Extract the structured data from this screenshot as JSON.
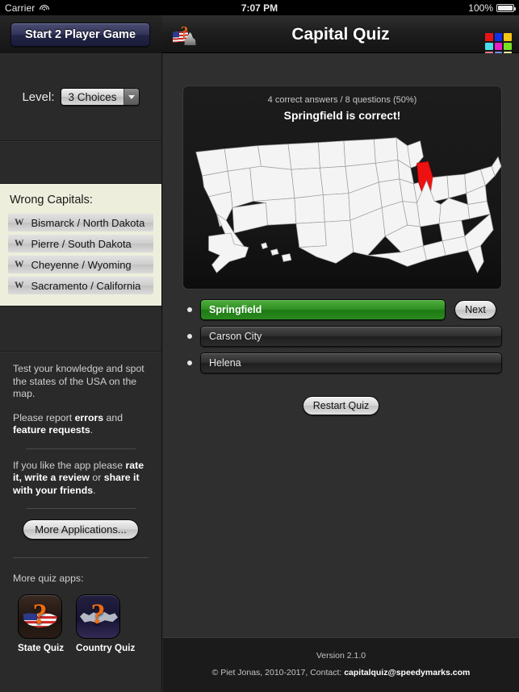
{
  "statusbar": {
    "carrier": "Carrier",
    "wifi_icon": "wifi-icon",
    "time": "7:07 PM",
    "battery_percent": "100%",
    "battery_icon": "battery-full-icon"
  },
  "navbar": {
    "two_player_button": "Start 2 Player Game",
    "app_icon": "capital-quiz-app-icon",
    "title": "Capital Quiz",
    "grid_icon": "color-grid-icon",
    "grid_colors": [
      "#e81414",
      "#1430e8",
      "#f5c518",
      "#46e0e8",
      "#e81ec8",
      "#7ae024",
      "#f07a8c",
      "#7a8cf0",
      "#f2ee9a"
    ]
  },
  "sidebar": {
    "level": {
      "label": "Level:",
      "selected": "3 Choices",
      "dropdown_icon": "chevron-down-icon"
    },
    "wrong_capitals": {
      "title": "Wrong Capitals:",
      "badge": "W",
      "items": [
        "Bismarck / North Dakota",
        "Pierre / South Dakota",
        "Cheyenne / Wyoming",
        "Sacramento / California"
      ]
    },
    "info": {
      "paragraph1_plain": "Test your knowledge and spot the states of the USA on the map.",
      "p2_a": "Please report ",
      "p2_b": "errors",
      "p2_c": " and ",
      "p2_d": "feature requests",
      "p2_e": ".",
      "p3_a": "If you like the app please ",
      "p3_b": "rate it, write a review",
      "p3_c": " or ",
      "p3_d": "share it with your friends",
      "p3_e": "."
    },
    "more_applications_button": "More Applications...",
    "more_quiz_apps_label": "More quiz apps:",
    "quiz_apps": [
      {
        "name": "State Quiz",
        "icon": "state-quiz-icon"
      },
      {
        "name": "Country Quiz",
        "icon": "country-quiz-icon"
      }
    ]
  },
  "quiz": {
    "score_line": "4 correct answers / 8 questions (50%)",
    "result_line": "Springfield is correct!",
    "map": {
      "icon": "usa-map",
      "highlighted_state": "Illinois",
      "highlight_color": "#ee1111",
      "state_fill": "#f4f4f4",
      "background": "#141414"
    },
    "answers": [
      {
        "label": "Springfield",
        "state": "correct"
      },
      {
        "label": "Carson City",
        "state": "normal"
      },
      {
        "label": "Helena",
        "state": "normal"
      }
    ],
    "next_button": "Next",
    "restart_button": "Restart Quiz"
  },
  "footer": {
    "version": "Version 2.1.0",
    "copyright_prefix": "© Piet Jonas, 2010-2017, Contact: ",
    "contact_email": "capitalquiz@speedymarks.com"
  }
}
